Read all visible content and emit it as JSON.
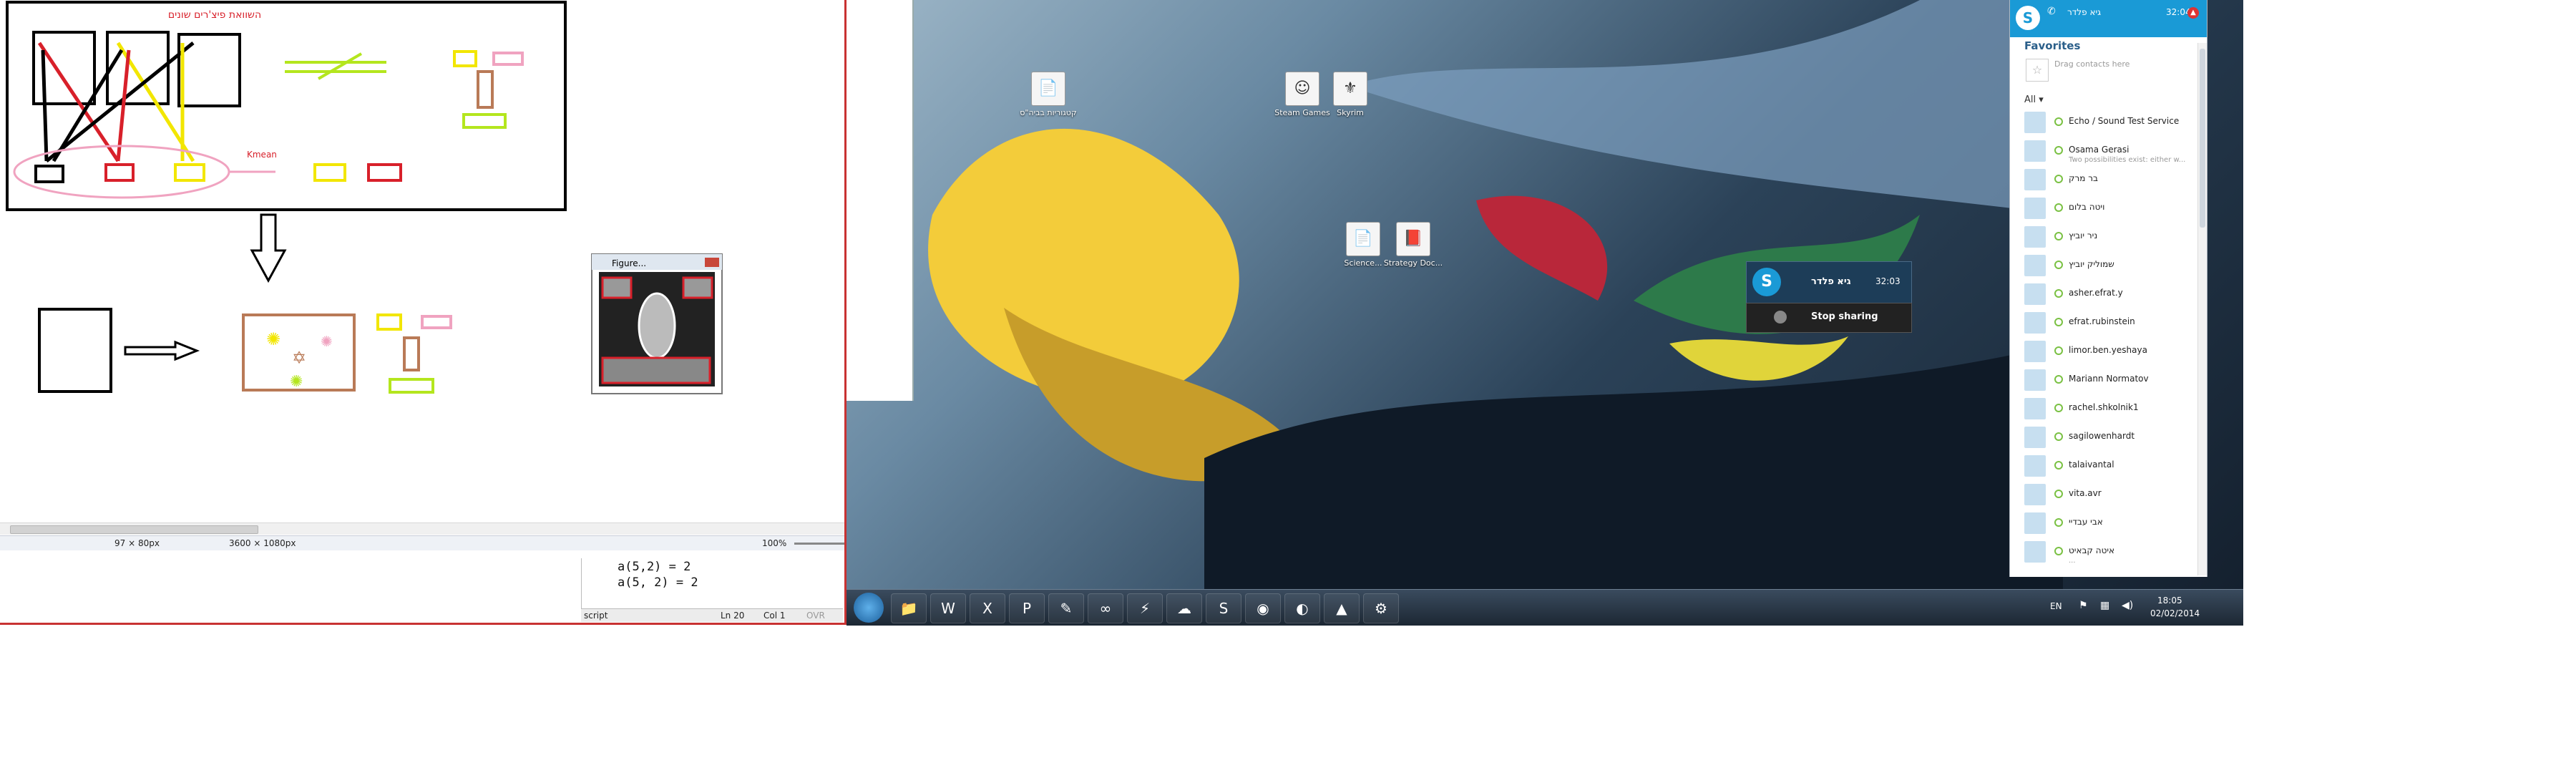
{
  "paint": {
    "title_annotation": "השוואת פיצ'רים שונים",
    "kmean_label": "Kmean",
    "figure_title": "Figure...",
    "status": {
      "selection_size": "97 × 80px",
      "image_size": "3600 × 1080px",
      "zoom": "100%"
    }
  },
  "matlab": {
    "lines": [
      "a(5,2) = 2",
      "a(5, 2) = 2"
    ],
    "status_mode": "script",
    "ln": "Ln  20",
    "col": "Col  1",
    "ovr": "OVR"
  },
  "desktop": {
    "icons": [
      {
        "label": "קטגוריות בביה\"ס",
        "glyph": "📄"
      },
      {
        "label": "Steam Games",
        "glyph": "☺"
      },
      {
        "label": "Skyrim",
        "glyph": "⚜"
      },
      {
        "label": "Science...",
        "glyph": "📄"
      },
      {
        "label": "Strategy Doc...",
        "glyph": "📕"
      }
    ],
    "share_toast": {
      "name": "גיא פלדר",
      "time": "32:03",
      "stop_label": "Stop sharing"
    }
  },
  "skype": {
    "header_name": "גיא פלדר",
    "header_time": "32:04",
    "favorites_title": "Favorites",
    "drop_hint": "Drag contacts here",
    "filter_label": "All ▾",
    "contacts": [
      {
        "name": "Echo / Sound Test Service",
        "mood": ""
      },
      {
        "name": "Osama Gerasi",
        "mood": "Two possibilities exist: either w..."
      },
      {
        "name": "בר מרק",
        "mood": ""
      },
      {
        "name": "ויטה בלום",
        "mood": ""
      },
      {
        "name": "ניר יוביץ",
        "mood": ""
      },
      {
        "name": "שמוליק יוביץ",
        "mood": ""
      },
      {
        "name": "asher.efrat.y",
        "mood": ""
      },
      {
        "name": "efrat.rubinstein",
        "mood": ""
      },
      {
        "name": "limor.ben.yeshaya",
        "mood": ""
      },
      {
        "name": "Mariann Normatov",
        "mood": ""
      },
      {
        "name": "rachel.shkolnik1",
        "mood": ""
      },
      {
        "name": "sagilowenhardt",
        "mood": ""
      },
      {
        "name": "talaivantal",
        "mood": ""
      },
      {
        "name": "vita.avr",
        "mood": ""
      },
      {
        "name": "אבי עבדיי",
        "mood": ""
      },
      {
        "name": "איטה קבאיט",
        "mood": "..."
      }
    ]
  },
  "taskbar": {
    "buttons": [
      {
        "icon": "folder-icon",
        "glyph": "📁"
      },
      {
        "icon": "word-icon",
        "glyph": "W"
      },
      {
        "icon": "excel-icon",
        "glyph": "X"
      },
      {
        "icon": "powerpoint-icon",
        "glyph": "P"
      },
      {
        "icon": "notepad-icon",
        "glyph": "✎"
      },
      {
        "icon": "visual-studio-icon",
        "glyph": "∞"
      },
      {
        "icon": "lightning-icon",
        "glyph": "⚡"
      },
      {
        "icon": "chat-icon",
        "glyph": "☁"
      },
      {
        "icon": "skype-icon",
        "glyph": "S"
      },
      {
        "icon": "firefox-icon",
        "glyph": "◉"
      },
      {
        "icon": "media-icon",
        "glyph": "◐"
      },
      {
        "icon": "matlab-icon",
        "glyph": "▲"
      },
      {
        "icon": "settings-icon",
        "glyph": "⚙"
      }
    ],
    "tray": {
      "language": "EN",
      "time": "18:05",
      "date": "02/02/2014"
    }
  },
  "colors": {
    "red": "#d8202a",
    "yellow": "#f2e600",
    "pink": "#f0a3c0",
    "lime": "#b4e61e",
    "brown": "#b97a57",
    "skype_blue": "#1a9ad6"
  }
}
